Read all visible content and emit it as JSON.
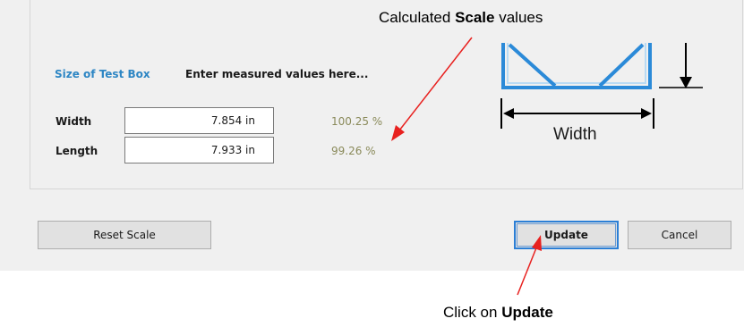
{
  "annotations": {
    "top_prefix": "Calculated ",
    "top_bold": "Scale",
    "top_suffix": " values",
    "bottom_prefix": "Click on ",
    "bottom_bold": "Update"
  },
  "section": {
    "title": "Size of Test Box",
    "hint": "Enter measured values here..."
  },
  "rows": [
    {
      "label": "Width",
      "value": "7.854 in",
      "percent": "100.25 %"
    },
    {
      "label": "Length",
      "value": "7.933 in",
      "percent": "99.26 %"
    }
  ],
  "diagram": {
    "caption": "Width"
  },
  "buttons": {
    "reset_label": "Reset Scale",
    "update_label": "Update",
    "cancel_label": "Cancel"
  },
  "colors": {
    "accent_blue": "#2d86c4",
    "diagram_blue": "#2b8ad8",
    "annotation_red": "#e8211f",
    "percent_text": "#8a8a5a"
  }
}
